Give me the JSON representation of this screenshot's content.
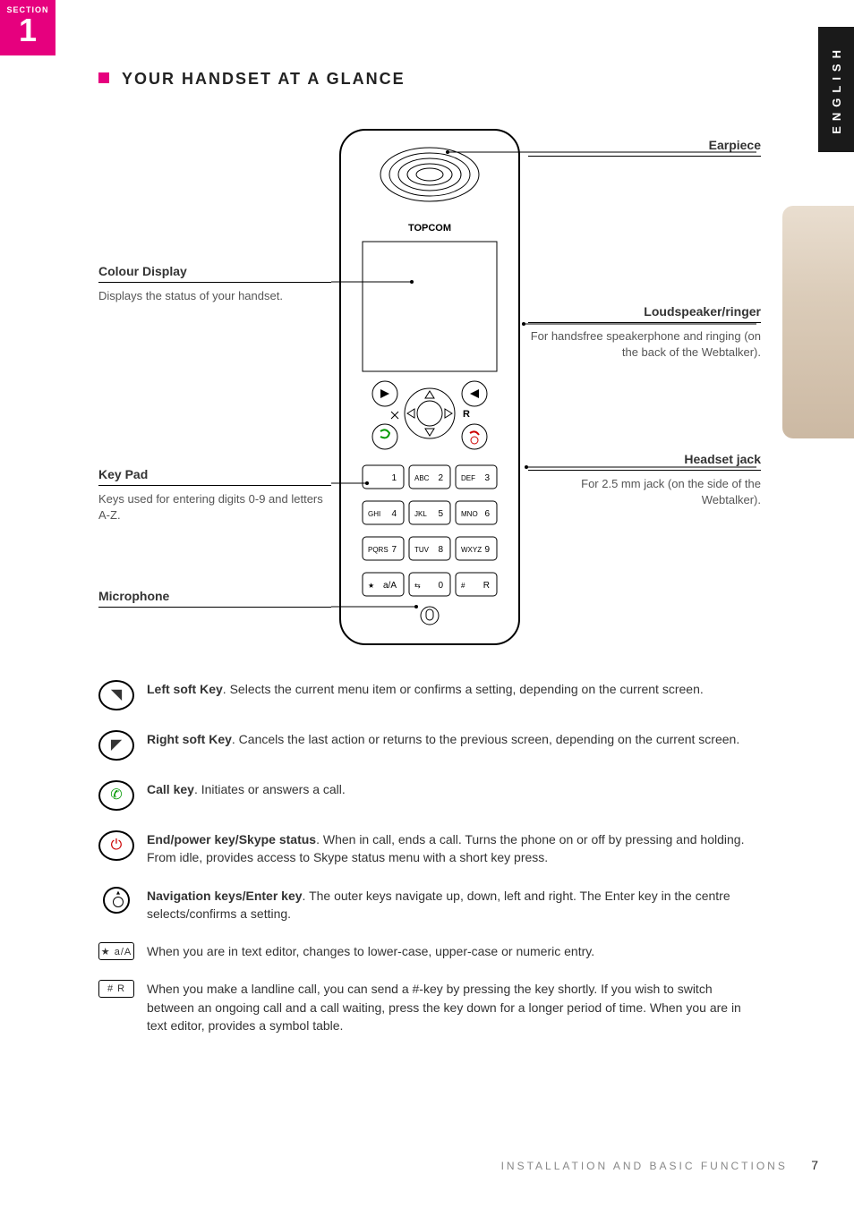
{
  "section": {
    "label": "SECTION",
    "number": "1"
  },
  "language_tab": "ENGLISH",
  "heading": "YOUR HANDSET AT A GLANCE",
  "handset_brand": "TOPCOM",
  "handset_nav_r": "R",
  "keypad_rows": [
    [
      {
        "sub": "",
        "num": "1"
      },
      {
        "sub": "ABC",
        "num": "2"
      },
      {
        "sub": "DEF",
        "num": "3"
      }
    ],
    [
      {
        "sub": "GHI",
        "num": "4"
      },
      {
        "sub": "JKL",
        "num": "5"
      },
      {
        "sub": "MNO",
        "num": "6"
      }
    ],
    [
      {
        "sub": "PQRS",
        "num": "7"
      },
      {
        "sub": "TUV",
        "num": "8"
      },
      {
        "sub": "WXYZ",
        "num": "9"
      }
    ],
    [
      {
        "sub": "★",
        "num": "a/A"
      },
      {
        "sub": "⇆",
        "num": "0"
      },
      {
        "sub": "#",
        "num": "R"
      }
    ]
  ],
  "callouts": {
    "earpiece": {
      "title": "Earpiece",
      "desc": ""
    },
    "display": {
      "title": "Colour Display",
      "desc": "Displays the status of your handset."
    },
    "loudspeaker": {
      "title": "Loudspeaker/ringer",
      "desc": "For handsfree speakerphone and ringing (on the back of the Webtalker)."
    },
    "headset": {
      "title": "Headset jack",
      "desc": "For 2.5 mm jack (on the side of the Webtalker)."
    },
    "keypad": {
      "title": "Key Pad",
      "desc": "Keys used for entering digits 0-9 and letters A-Z."
    },
    "mic": {
      "title": "Microphone",
      "desc": ""
    }
  },
  "keys": [
    {
      "icon": "left-soft",
      "title": "Left soft Key",
      "desc": "Selects the current menu item or confirms a setting, depending on the current screen."
    },
    {
      "icon": "right-soft",
      "title": "Right soft Key",
      "desc": "Cancels the last action or returns to the previous screen, depending on the current screen."
    },
    {
      "icon": "call",
      "title": "Call key",
      "desc": "Initiates or answers a call."
    },
    {
      "icon": "end",
      "title": "End/power key/Skype status",
      "desc": "When in call, ends a call. Turns the phone on or off by pressing and holding. From idle, provides access to Skype status menu with a short key press."
    },
    {
      "icon": "nav",
      "title": "Navigation keys/Enter key",
      "desc": "The outer keys navigate up, down, left and right. The Enter key in the centre selects/confirms a setting."
    },
    {
      "icon": "star",
      "title": "",
      "desc": "When you are in text editor, changes to lower-case, upper-case or numeric entry."
    },
    {
      "icon": "hash",
      "title": "",
      "desc": "When you make a landline call, you can send a #-key by pressing the key shortly. If you wish to switch between an ongoing call and a call waiting, press the key down for a longer period of time. When you are in text editor, provides a symbol table."
    }
  ],
  "key_labels": {
    "star": "★ a/A",
    "hash": "# R"
  },
  "footer": {
    "text": "INSTALLATION AND BASIC FUNCTIONS",
    "page": "7"
  }
}
